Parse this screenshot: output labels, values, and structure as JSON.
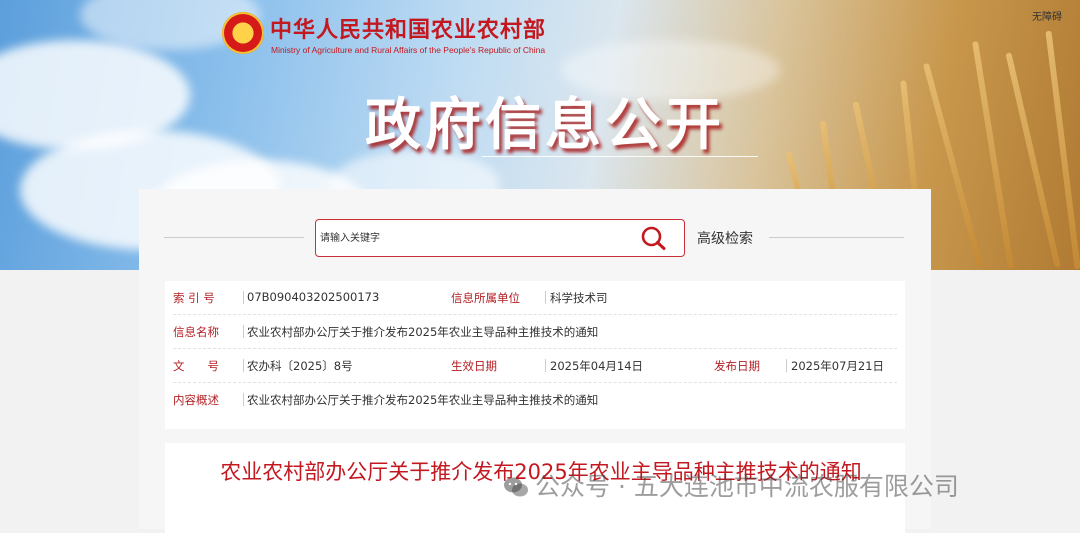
{
  "header": {
    "ministry_cn": "中华人民共和国农业农村部",
    "ministry_en": "Ministry of Agriculture and Rural Affairs of the People's Republic of China",
    "accessibility": "无障碍",
    "title": "政府信息公开"
  },
  "search": {
    "placeholder": "请输入关键字",
    "advanced": "高级检索"
  },
  "info": {
    "index_label": "索 引 号",
    "index_value": "07B090403202500173",
    "unit_label": "信息所属单位",
    "unit_value": "科学技术司",
    "name_label": "信息名称",
    "name_value": "农业农村部办公厅关于推介发布2025年农业主导品种主推技术的通知",
    "doc_label": "文　　号",
    "doc_value": "农办科〔2025〕8号",
    "effective_label": "生效日期",
    "effective_value": "2025年04月14日",
    "publish_label": "发布日期",
    "publish_value": "2025年07月21日",
    "summary_label": "内容概述",
    "summary_value": "农业农村部办公厅关于推介发布2025年农业主导品种主推技术的通知"
  },
  "document": {
    "title": "农业农村部办公厅关于推介发布2025年农业主导品种主推技术的通知"
  },
  "watermark": "公众号 · 五大连池市中流农服有限公司",
  "colors": {
    "brand_red": "#c3181f",
    "label_red": "#b42024"
  }
}
